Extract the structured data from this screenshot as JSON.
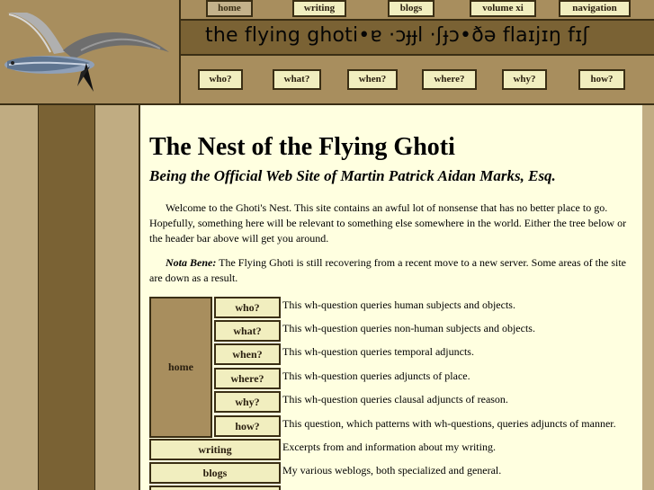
{
  "topnav": {
    "home": "home",
    "writing": "writing",
    "blogs": "blogs",
    "volume": "volume xi",
    "navigation": "navigation"
  },
  "header": {
    "title": "the flying ghoti•ɐ ·ɔɟɟl ·ʃɟɔ•ðə flaɪjɪŋ fɪʃ"
  },
  "qnav": {
    "who": "who?",
    "what": "what?",
    "when": "when?",
    "where": "where?",
    "why": "why?",
    "how": "how?"
  },
  "main": {
    "title": "The Nest of the Flying Ghoti",
    "subtitle": "Being the Official Web Site of Martin Patrick Aidan Marks, Esq.",
    "intro": "Welcome to the Ghoti's Nest. This site contains an awful lot of nonsense that has no better place to go. Hopefully, something here will be relevant to something else somewhere in the world. Either the tree below or the header bar above will get you around.",
    "nota_label": "Nota Bene:",
    "nota_text": " The Flying Ghoti is still recovering from a recent move to a new server. Some areas of the site are down as a result."
  },
  "tree": {
    "home": "home",
    "items": [
      {
        "label": "who?",
        "desc": "This wh-question queries human subjects and objects."
      },
      {
        "label": "what?",
        "desc": "This wh-question queries non-human subjects and objects."
      },
      {
        "label": "when?",
        "desc": "This wh-question queries temporal adjuncts."
      },
      {
        "label": "where?",
        "desc": "This wh-question queries adjuncts of place."
      },
      {
        "label": "why?",
        "desc": "This wh-question queries clausal adjuncts of reason."
      },
      {
        "label": "how?",
        "desc": "This question, which patterns with wh-questions, queries adjuncts of manner."
      },
      {
        "label": "writing",
        "desc": "Excerpts from and information about my writing."
      },
      {
        "label": "blogs",
        "desc": "My various weblogs, both specialized and general."
      }
    ]
  },
  "colors": {
    "dark_brown": "#7a6234",
    "mid_tan": "#a88e5e",
    "light_tan": "#c0ac82",
    "cream": "#f1eebf",
    "page_bg": "#ffffe0",
    "border": "#3a2e14"
  }
}
